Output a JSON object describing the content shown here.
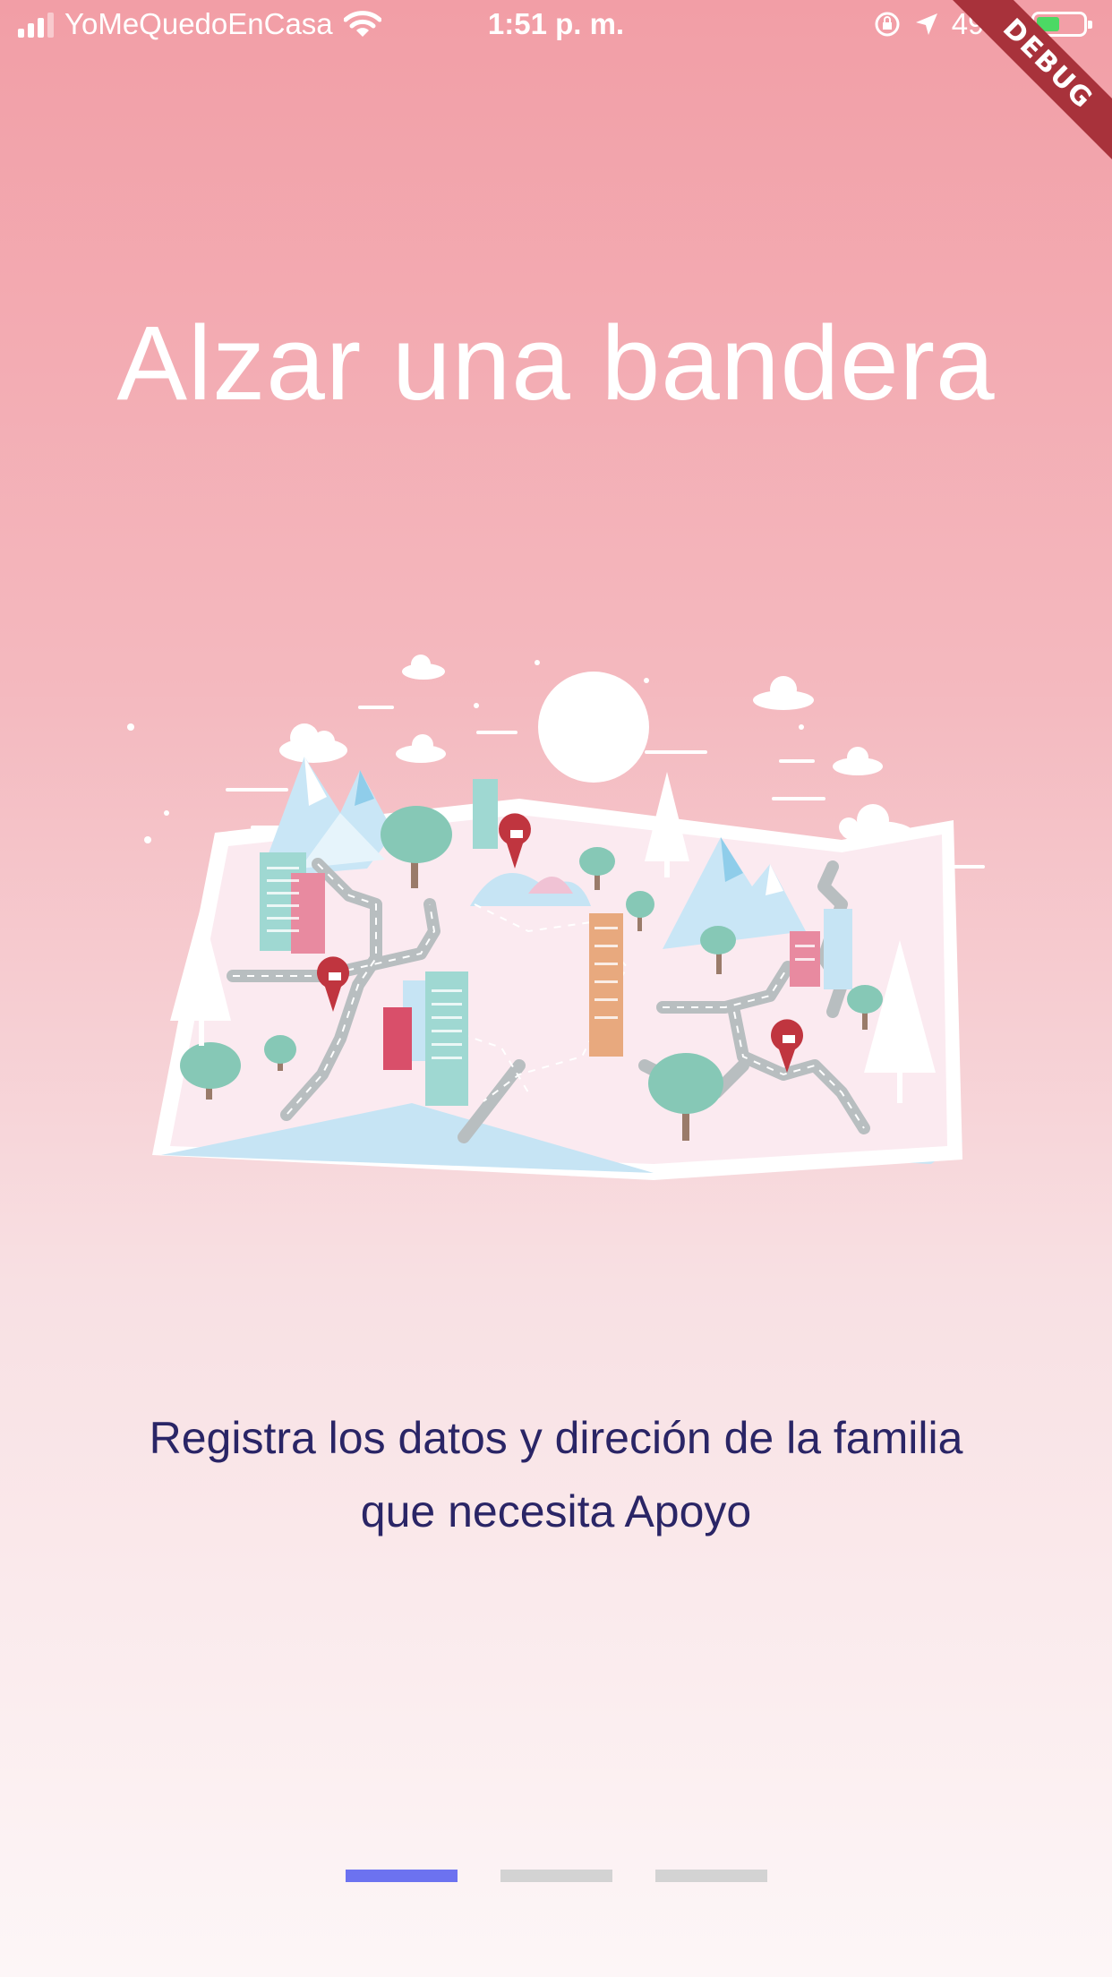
{
  "status_bar": {
    "carrier": "YoMeQuedoEnCasa",
    "time": "1:51 p. m.",
    "battery": "49 %",
    "battery_level": 0.49
  },
  "debug_banner": "DEBUG",
  "onboarding": {
    "title": "Alzar una bandera",
    "description_line1": "Registra los datos y direción de la familia",
    "description_line2": "que necesita Apoyo",
    "page_count": 3,
    "active_page": 0
  },
  "colors": {
    "gradient_top": "#f29ea6",
    "gradient_bottom": "#fdf6f7",
    "title_text": "#ffffff",
    "description_text": "#2a2566",
    "indicator_active": "#6c72f0",
    "indicator_inactive": "#d3d3d3",
    "debug_ribbon": "#a8323b"
  }
}
